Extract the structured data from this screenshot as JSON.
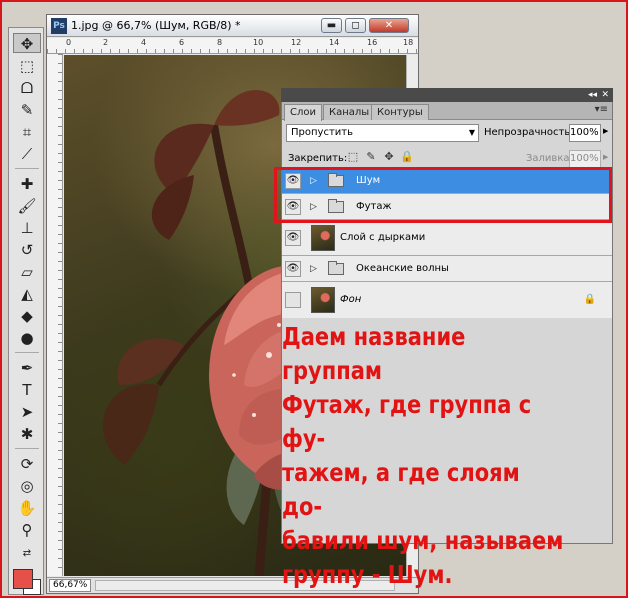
{
  "document": {
    "app_icon": "Ps",
    "title": "1.jpg @ 66,7% (Шум, RGB/8) *",
    "zoom": "66,67%",
    "ruler_marks": [
      "0",
      "2",
      "4",
      "6",
      "8",
      "10",
      "12",
      "14",
      "16",
      "18"
    ]
  },
  "window_controls": {
    "minimize": "▬",
    "restore": "◻",
    "close": "✕"
  },
  "panel": {
    "collapse_glyph": "◂◂",
    "close_glyph": "✕",
    "menu_glyph": "▾≡",
    "tabs": [
      {
        "label": "Слои",
        "active": true
      },
      {
        "label": "Каналы",
        "active": false
      },
      {
        "label": "Контуры",
        "active": false
      }
    ],
    "blend_mode": "Пропустить",
    "opacity_label": "Непрозрачность:",
    "opacity_value": "100%",
    "lock_label": "Закрепить:",
    "fill_label": "Заливка:",
    "fill_value": "100%"
  },
  "layers": [
    {
      "name": "Шум",
      "type": "group",
      "visible": true,
      "selected": true
    },
    {
      "name": "Футаж",
      "type": "group",
      "visible": true,
      "selected": false
    },
    {
      "name": "Слой с дырками",
      "type": "layer",
      "visible": true,
      "selected": false
    },
    {
      "name": "Океанские волны",
      "type": "group",
      "visible": true,
      "selected": false
    },
    {
      "name": "Фон",
      "type": "background",
      "visible": false,
      "selected": false,
      "locked": true
    }
  ],
  "annotation": {
    "text": "Даем название группам\nФутаж, где группа с фу-\nтажем, а где слоям до-\nбавили шум, называем\nгруппу - Шум.",
    "color": "#e11313"
  },
  "colors": {
    "highlight": "#e1141e",
    "selection": "#3d8ee2",
    "foreground_swatch": "#e65048",
    "background_swatch": "#ffffff"
  },
  "icons": {
    "eye": "eye-icon",
    "folder": "folder-icon",
    "lock": "lock-icon",
    "disclosure": "triangle-right-icon"
  }
}
